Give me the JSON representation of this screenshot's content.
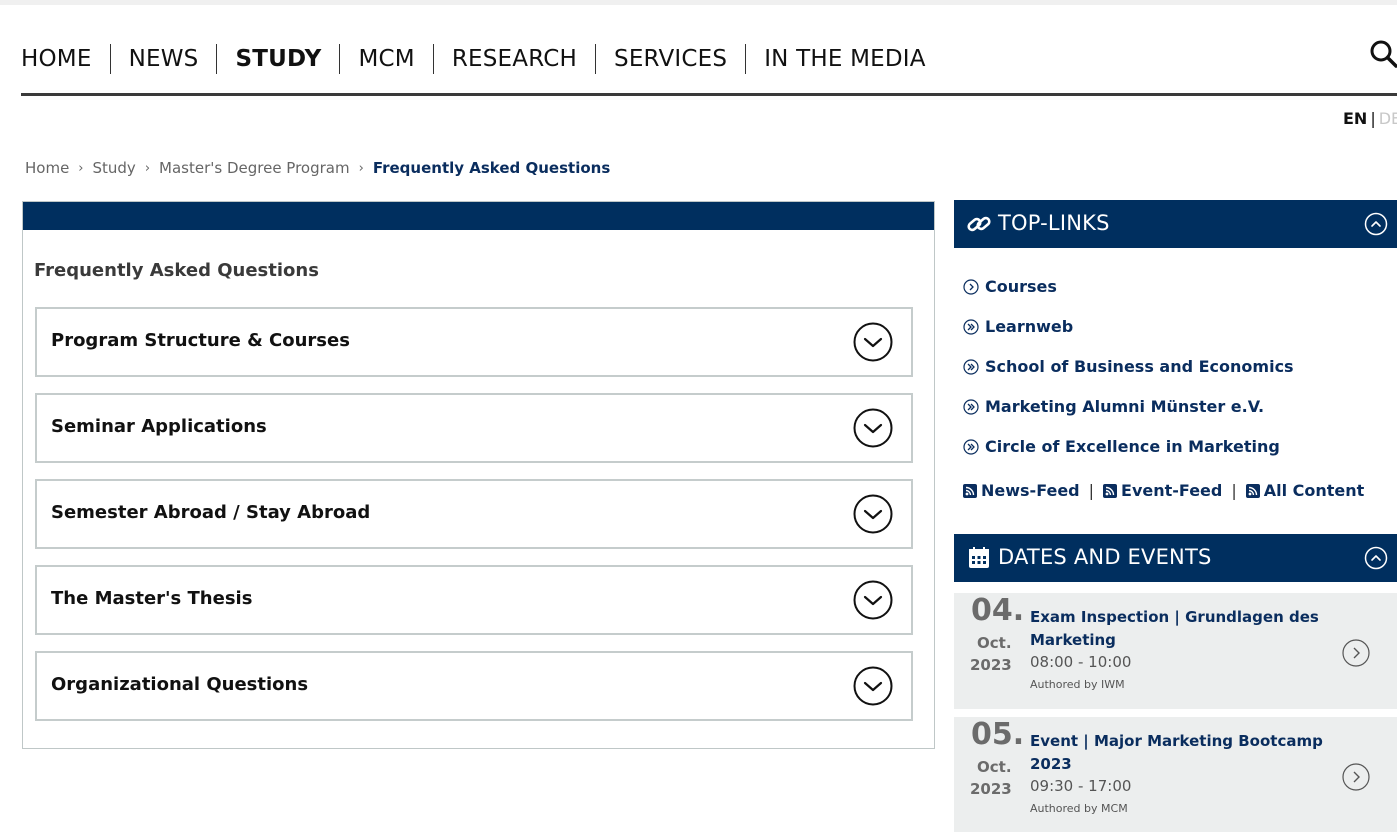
{
  "nav": {
    "items": [
      {
        "label": "HOME",
        "active": false
      },
      {
        "label": "NEWS",
        "active": false
      },
      {
        "label": "STUDY",
        "active": true
      },
      {
        "label": "MCM",
        "active": false
      },
      {
        "label": "RESEARCH",
        "active": false
      },
      {
        "label": "SERVICES",
        "active": false
      },
      {
        "label": "IN THE MEDIA",
        "active": false
      }
    ],
    "search_icon": "search-icon"
  },
  "language": {
    "current": "EN",
    "separator": "|",
    "other": "DE"
  },
  "breadcrumb": {
    "items": [
      "Home",
      "Study",
      "Master's Degree Program"
    ],
    "separator": "›",
    "current": "Frequently Asked Questions"
  },
  "faq": {
    "title": "Frequently Asked Questions",
    "items": [
      "Program Structure & Courses",
      "Seminar Applications",
      "Semester Abroad / Stay Abroad",
      "The Master's Thesis",
      "Organizational Questions"
    ],
    "toggle_icon": "chevron-down-circle-icon"
  },
  "top_links": {
    "title": "TOP-LINKS",
    "header_icon": "link-icon",
    "collapse_icon": "chevron-up-circle-icon",
    "links": [
      {
        "label": "Courses",
        "icon": "chevron-right-circle-icon"
      },
      {
        "label": "Learnweb",
        "icon": "double-chevron-right-circle-icon"
      },
      {
        "label": "School of Business and Economics",
        "icon": "double-chevron-right-circle-icon"
      },
      {
        "label": "Marketing Alumni Münster e.V.",
        "icon": "double-chevron-right-circle-icon"
      },
      {
        "label": "Circle of Excellence in Marketing",
        "icon": "double-chevron-right-circle-icon"
      }
    ],
    "feeds": [
      "News-Feed",
      "Event-Feed",
      "All Content"
    ],
    "feed_separator": "|",
    "feed_icon": "rss-icon"
  },
  "events": {
    "title": "DATES AND EVENTS",
    "header_icon": "calendar-icon",
    "collapse_icon": "chevron-up-circle-icon",
    "items": [
      {
        "day": "04.",
        "month": "Oct.",
        "year": "2023",
        "title": "Exam Inspection | Grundlagen des Marketing",
        "time": "08:00 - 10:00",
        "author": "Authored by IWM"
      },
      {
        "day": "05.",
        "month": "Oct.",
        "year": "2023",
        "title": "Event | Major Marketing Bootcamp 2023",
        "time": "09:30 - 17:00",
        "author": "Authored by MCM"
      }
    ]
  },
  "colors": {
    "primary_navy": "#002f5f",
    "link_navy": "#0a2d5e",
    "event_bg": "#eceeee",
    "border_gray": "#c5cccc"
  }
}
